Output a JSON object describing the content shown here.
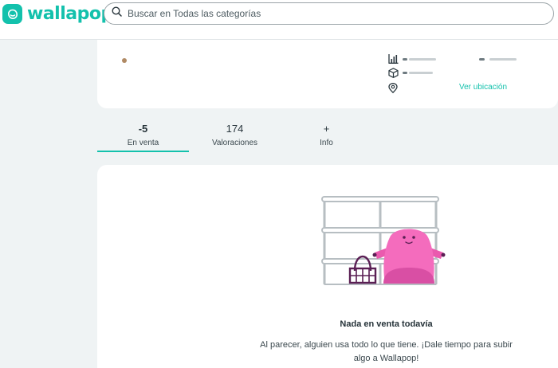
{
  "header": {
    "logo_text": "wallapop",
    "search_placeholder": "Buscar en Todas las categorías",
    "brand_color": "#13c1ac"
  },
  "profile": {
    "location_link": "Ver ubicación"
  },
  "tabs": [
    {
      "count": "-5",
      "label": "En venta",
      "active": true
    },
    {
      "count": "174",
      "label": "Valoraciones",
      "active": false
    },
    {
      "count": "+",
      "label": "Info",
      "active": false
    }
  ],
  "empty_state": {
    "title": "Nada en venta todavía",
    "description": "Al parecer, alguien usa todo lo que tiene. ¡Dale tiempo para subir algo a Wallapop!"
  }
}
